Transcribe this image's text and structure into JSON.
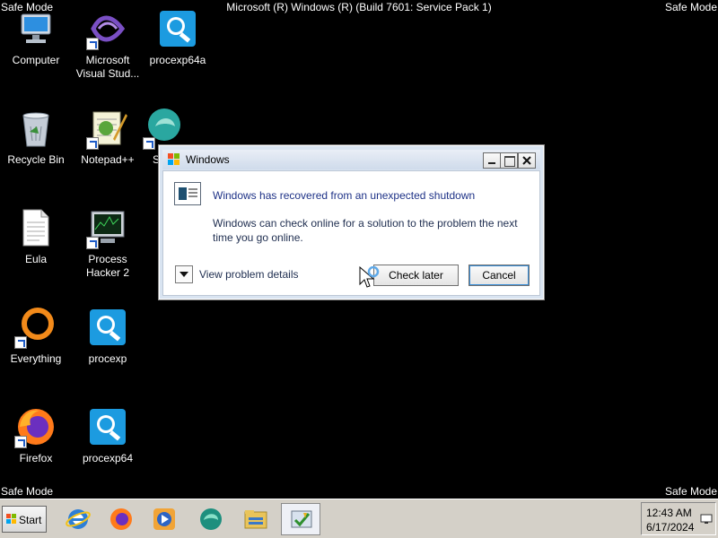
{
  "desktop": {
    "watermark_corner": "Safe Mode",
    "build_info": "Microsoft (R) Windows (R) (Build 7601: Service Pack 1)",
    "icons": [
      {
        "label": "Computer",
        "icon": "computer-icon"
      },
      {
        "label": "Microsoft Visual Stud...",
        "icon": "visual-studio-icon"
      },
      {
        "label": "procexp64a",
        "icon": "procexp-icon"
      },
      {
        "label": "Recycle Bin",
        "icon": "recycle-bin-icon"
      },
      {
        "label": "Notepad++",
        "icon": "notepadpp-icon"
      },
      {
        "label": "Eula",
        "icon": "document-icon"
      },
      {
        "label": "Process Hacker 2",
        "icon": "process-hacker-icon"
      },
      {
        "label": "Everything",
        "icon": "everything-icon"
      },
      {
        "label": "procexp",
        "icon": "procexp-icon"
      },
      {
        "label": "Firefox",
        "icon": "firefox-icon"
      },
      {
        "label": "procexp64",
        "icon": "procexp-icon"
      },
      {
        "label": "S",
        "icon": "app-icon"
      }
    ]
  },
  "dialog": {
    "title": "Windows",
    "heading": "Windows has recovered from an unexpected shutdown",
    "message": "Windows can check online for a solution to the problem the next time you go online.",
    "details_label": "View problem details",
    "check_later_label": "Check later",
    "cancel_label": "Cancel"
  },
  "taskbar": {
    "start_label": "Start",
    "pinned": [
      "internet-explorer-icon",
      "firefox-icon",
      "media-player-icon",
      "edge-icon",
      "explorer-icon",
      "action-center-icon"
    ],
    "clock_time": "12:43 AM",
    "clock_date": "6/17/2024"
  },
  "colors": {
    "desktop_bg": "#000000",
    "dialog_heading": "#1e3287",
    "taskbar_bg": "#d4d0c8"
  }
}
